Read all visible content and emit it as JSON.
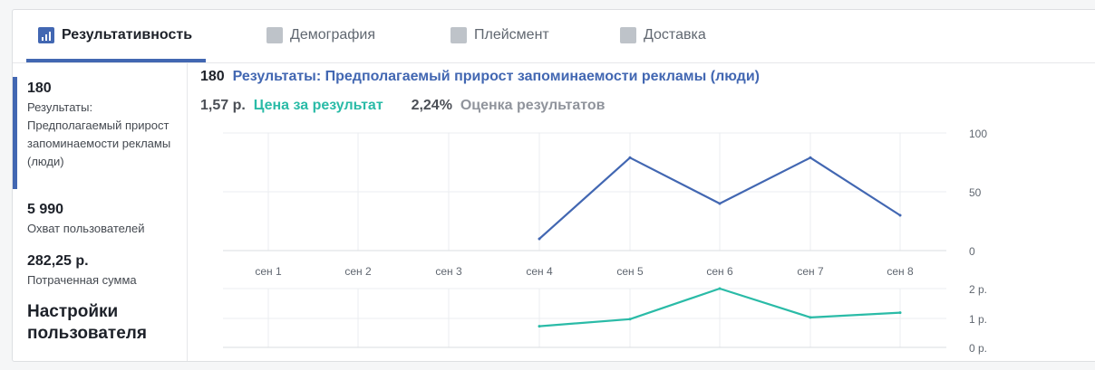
{
  "tabs": [
    {
      "label": "Результативность",
      "icon": "bar-chart-icon",
      "active": true
    },
    {
      "label": "Демография",
      "icon": "people-icon",
      "active": false
    },
    {
      "label": "Плейсмент",
      "icon": "placement-icon",
      "active": false
    },
    {
      "label": "Доставка",
      "icon": "delivery-chart-icon",
      "active": false
    }
  ],
  "sidebar": {
    "items": [
      {
        "value": "180",
        "label": "Результаты: Предполагаемый прирост запоминаемости рекламы (люди)"
      },
      {
        "value": "5 990",
        "label": "Охват пользователей"
      },
      {
        "value": "282,25 р.",
        "label": "Потраченная сумма"
      }
    ],
    "settings_label": "Настройки пользователя"
  },
  "summary": {
    "results_value": "180",
    "results_label": "Результаты: Предполагаемый прирост запоминаемости рекламы (люди)",
    "cost_value": "1,57 р.",
    "cost_label": "Цена за результат",
    "score_value": "2,24%",
    "score_label": "Оценка результатов"
  },
  "colors": {
    "accent": "#4267b2",
    "teal": "#2abba7"
  },
  "chart_data": [
    {
      "type": "line",
      "categories": [
        "сен 1",
        "сен 2",
        "сен 3",
        "сен 4",
        "сен 5",
        "сен 6",
        "сен 7",
        "сен 8"
      ],
      "series": [
        {
          "values": [
            null,
            null,
            null,
            10,
            79,
            40,
            79,
            30
          ]
        }
      ],
      "ylim": [
        0,
        100
      ],
      "yticks": [
        "100",
        "50",
        "0"
      ],
      "grid": true
    },
    {
      "type": "line",
      "categories": [
        "сен 1",
        "сен 2",
        "сен 3",
        "сен 4",
        "сен 5",
        "сен 6",
        "сен 7",
        "сен 8"
      ],
      "series": [
        {
          "values": [
            null,
            null,
            null,
            0.72,
            0.96,
            2.0,
            1.02,
            1.18
          ]
        }
      ],
      "ylim": [
        0,
        2
      ],
      "yticks": [
        "2 р.",
        "1 р.",
        "0 р."
      ],
      "grid": true
    }
  ]
}
